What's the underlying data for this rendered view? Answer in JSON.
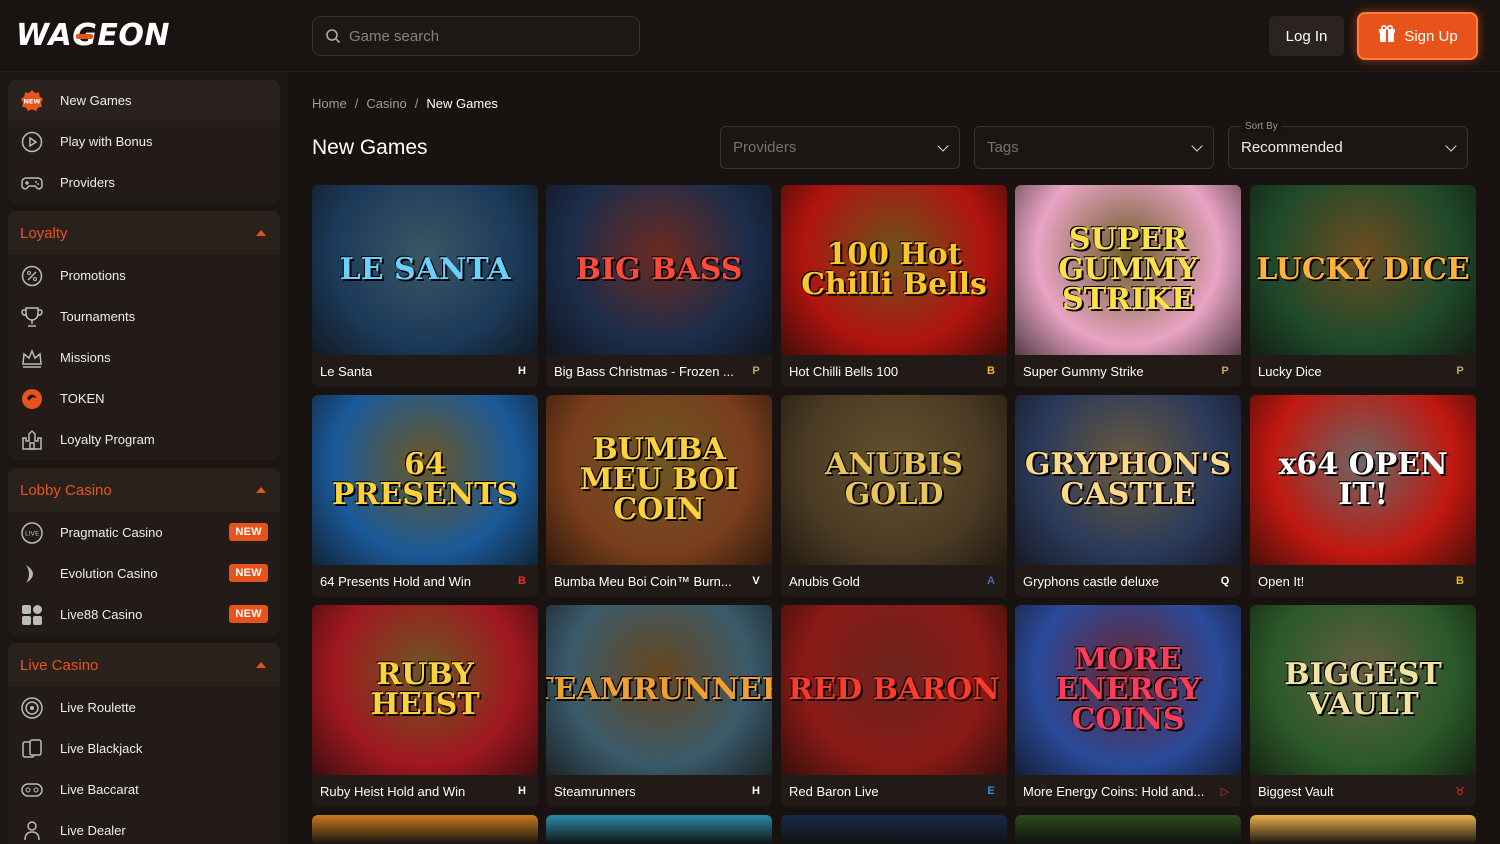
{
  "header": {
    "logo": "WAGEON",
    "search_placeholder": "Game search",
    "login_label": "Log In",
    "signup_label": "Sign Up"
  },
  "sidebar": {
    "top_items": [
      {
        "label": "New Games",
        "icon": "new-badge-icon"
      },
      {
        "label": "Play with Bonus",
        "icon": "play-circle-icon"
      },
      {
        "label": "Providers",
        "icon": "gamepad-icon"
      }
    ],
    "loyalty": {
      "title": "Loyalty",
      "items": [
        {
          "label": "Promotions",
          "icon": "percent-icon"
        },
        {
          "label": "Tournaments",
          "icon": "trophy-icon"
        },
        {
          "label": "Missions",
          "icon": "crown-icon"
        },
        {
          "label": "TOKEN",
          "icon": "token-icon"
        },
        {
          "label": "Loyalty Program",
          "icon": "castle-icon"
        }
      ]
    },
    "lobby_casino": {
      "title": "Lobby Casino",
      "items": [
        {
          "label": "Pragmatic Casino",
          "badge": "NEW",
          "icon": "live-icon"
        },
        {
          "label": "Evolution Casino",
          "badge": "NEW",
          "icon": "evolution-icon"
        },
        {
          "label": "Live88 Casino",
          "badge": "NEW",
          "icon": "grid-icon"
        }
      ]
    },
    "live_casino": {
      "title": "Live Casino",
      "items": [
        {
          "label": "Live Roulette",
          "icon": "roulette-icon"
        },
        {
          "label": "Live Blackjack",
          "icon": "cards-icon"
        },
        {
          "label": "Live Baccarat",
          "icon": "baccarat-icon"
        },
        {
          "label": "Live Dealer",
          "icon": "dealer-icon"
        }
      ]
    }
  },
  "breadcrumb": [
    "Home",
    "Casino",
    "New Games"
  ],
  "breadcrumb_sep": "/",
  "page_title": "New Games",
  "filters": {
    "providers_placeholder": "Providers",
    "tags_placeholder": "Tags",
    "sort_label": "Sort By",
    "sort_value": "Recommended"
  },
  "games": [
    {
      "name": "Le Santa",
      "art": "LE SANTA",
      "bg": "#1b3a5a",
      "fg": "#6ad0ff",
      "prov": "H",
      "provColor": "#ffffff"
    },
    {
      "name": "Big Bass Christmas - Frozen ...",
      "art": "BIG BASS",
      "bg": "#1b2d4a",
      "fg": "#ff4a3a",
      "prov": "P",
      "provColor": "#c9a66b"
    },
    {
      "name": "Hot Chilli Bells 100",
      "art": "100 Hot Chilli Bells",
      "bg": "#b0140e",
      "fg": "#ffc62a",
      "prov": "B",
      "provColor": "#f3b51a"
    },
    {
      "name": "Super Gummy Strike",
      "art": "SUPER GUMMY STRIKE",
      "bg": "#e9a4c4",
      "fg": "#ffe14a",
      "prov": "P",
      "provColor": "#c9a66b"
    },
    {
      "name": "Lucky Dice",
      "art": "LUCKY DICE",
      "bg": "#1f4a2a",
      "fg": "#ffb13a",
      "prov": "P",
      "provColor": "#c9a66b"
    },
    {
      "name": "64 Presents Hold and Win",
      "art": "64 PRESENTS",
      "bg": "#1a5a9a",
      "fg": "#ffd23a",
      "prov": "B",
      "provColor": "#e8312a"
    },
    {
      "name": "Bumba Meu Boi Coin™ Burn...",
      "art": "BUMBA MEU BOI COIN",
      "bg": "#7a3e1c",
      "fg": "#ffd23a",
      "prov": "V",
      "provColor": "#ffffff"
    },
    {
      "name": "Anubis Gold",
      "art": "ANUBIS GOLD",
      "bg": "#4a3a24",
      "fg": "#e8c45a",
      "prov": "A",
      "provColor": "#4a6aa8"
    },
    {
      "name": "Gryphons castle deluxe",
      "art": "GRYPHON'S CASTLE",
      "bg": "#2a3a5a",
      "fg": "#ffd98a",
      "prov": "Q",
      "provColor": "#ffffff"
    },
    {
      "name": "Open It!",
      "art": "x64 OPEN IT!",
      "bg": "#c01810",
      "fg": "#ffffff",
      "prov": "B",
      "provColor": "#f3b51a"
    },
    {
      "name": "Ruby Heist Hold and Win",
      "art": "RUBY HEIST",
      "bg": "#a01820",
      "fg": "#ffd23a",
      "prov": "H",
      "provColor": "#ffffff"
    },
    {
      "name": "Steamrunners",
      "art": "STEAMRUNNERS",
      "bg": "#3a5a6a",
      "fg": "#f0a030",
      "prov": "H",
      "provColor": "#ffffff"
    },
    {
      "name": "Red Baron Live",
      "art": "RED BARON",
      "bg": "#8a1a16",
      "fg": "#ff3a2a",
      "prov": "E",
      "provColor": "#3a8ae8"
    },
    {
      "name": "More Energy Coins: Hold and...",
      "art": "MORE ENERGY COINS",
      "bg": "#2a4a9a",
      "fg": "#ff3a5a",
      "prov": "▷",
      "provColor": "#e8312a"
    },
    {
      "name": "Biggest Vault",
      "art": "BIGGEST VAULT",
      "bg": "#2a5a2a",
      "fg": "#f3e3a0",
      "prov": "♉",
      "provColor": "#e8312a"
    }
  ],
  "partial_row_colors": [
    "#c87a1a",
    "#2a8aa8",
    "#1a2a4a",
    "#2a4a1a",
    "#e8b04a"
  ],
  "colors": {
    "accent": "#e8531c",
    "bg": "#181210",
    "sidebar": "#1c1613"
  }
}
